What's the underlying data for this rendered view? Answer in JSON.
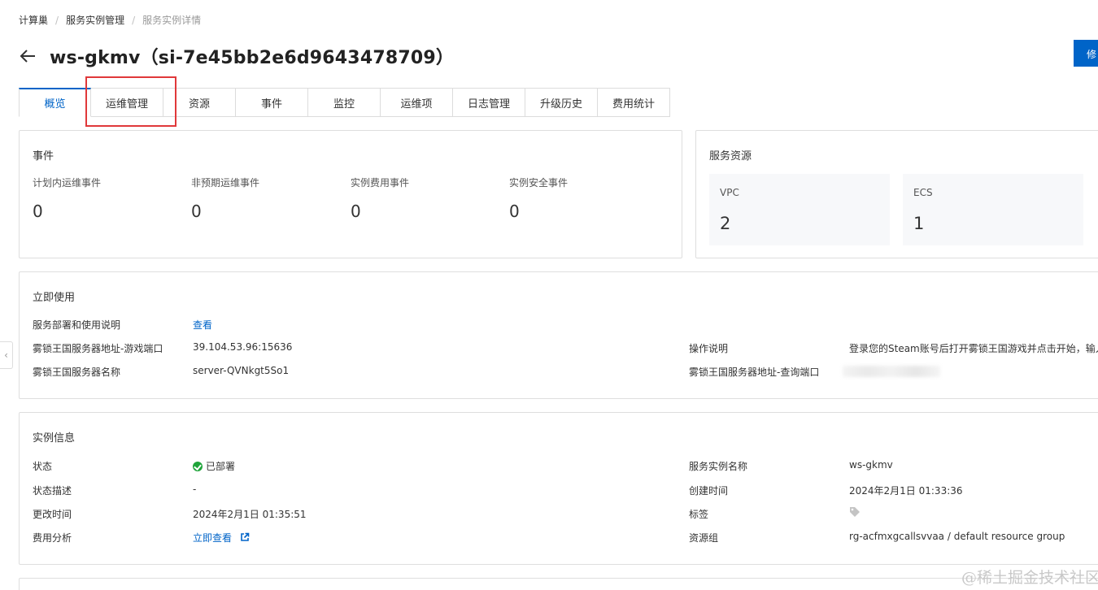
{
  "breadcrumb": {
    "item1": "计算巢",
    "item2": "服务实例管理",
    "item3": "服务实例详情",
    "sep": "/"
  },
  "header": {
    "title": "ws-gkmv（si-7e45bb2e6d9643478709）",
    "edit_label": "修"
  },
  "tabs": [
    "概览",
    "运维管理",
    "资源",
    "事件",
    "监控",
    "运维项",
    "日志管理",
    "升级历史",
    "费用统计"
  ],
  "events_card": {
    "title": "事件",
    "items": [
      {
        "label": "计划内运维事件",
        "value": "0"
      },
      {
        "label": "非预期运维事件",
        "value": "0"
      },
      {
        "label": "实例费用事件",
        "value": "0"
      },
      {
        "label": "实例安全事件",
        "value": "0"
      }
    ]
  },
  "resources_card": {
    "title": "服务资源",
    "items": [
      {
        "label": "VPC",
        "value": "2"
      },
      {
        "label": "ECS",
        "value": "1"
      }
    ]
  },
  "use_card": {
    "title": "立即使用",
    "deploy_label": "服务部署和使用说明",
    "deploy_link": "查看",
    "game_port_label": "雾锁王国服务器地址-游戏端口",
    "game_port_value": "39.104.53.96:15636",
    "server_name_label": "雾锁王国服务器名称",
    "server_name_value": "server-QVNkgt5So1",
    "instructions_label": "操作说明",
    "instructions_value": "登录您的Steam账号后打开雾锁王国游戏并点击开始，输入",
    "query_port_label": "雾锁王国服务器地址-查询端口"
  },
  "info_card": {
    "title": "实例信息",
    "status_label": "状态",
    "status_value": "已部署",
    "status_desc_label": "状态描述",
    "status_desc_value": "-",
    "modified_label": "更改时间",
    "modified_value": "2024年2月1日 01:35:51",
    "cost_label": "费用分析",
    "cost_link": "立即查看",
    "name_label": "服务实例名称",
    "name_value": "ws-gkmv",
    "created_label": "创建时间",
    "created_value": "2024年2月1日 01:33:36",
    "tags_label": "标签",
    "rg_label": "资源组",
    "rg_value": "rg-acfmxgcallsvvaa / default resource group"
  },
  "status_color": "#1fa43a",
  "accent_color": "#0064c8",
  "watermark": "@稀土掘金技术社区"
}
